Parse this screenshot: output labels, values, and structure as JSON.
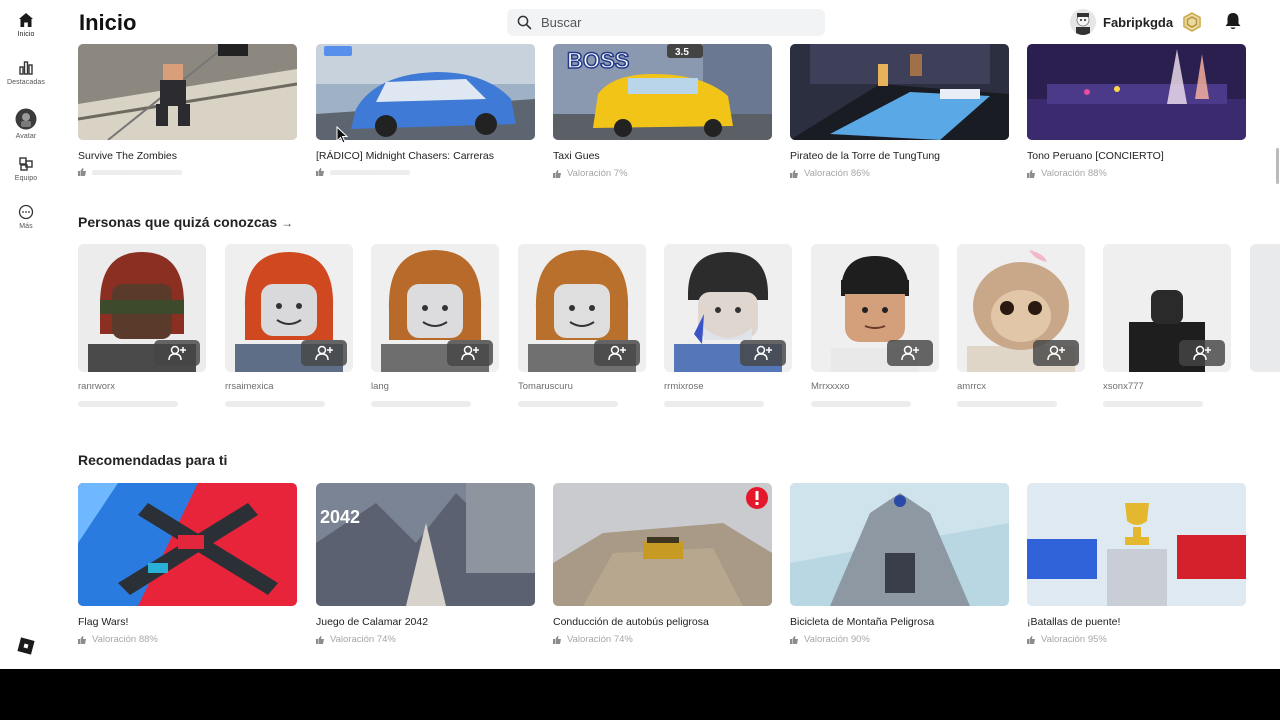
{
  "header": {
    "title": "Inicio",
    "search_placeholder": "Buscar",
    "username": "Fabripkgda"
  },
  "sidebar": {
    "items": [
      {
        "label": "Inicio",
        "icon": "home-icon"
      },
      {
        "label": "Destacadas",
        "icon": "charts-icon"
      },
      {
        "label": "Avatar",
        "icon": "avatar-icon"
      },
      {
        "label": "Equipo",
        "icon": "team-icon"
      },
      {
        "label": "Más",
        "icon": "more-icon"
      }
    ]
  },
  "continue_row": {
    "games": [
      {
        "title": "Survive The Zombies",
        "rating": ""
      },
      {
        "title": "[RÁDICO] Midnight Chasers: Carreras",
        "rating": ""
      },
      {
        "title": "Taxi Gues",
        "rating": "Valoración 7%"
      },
      {
        "title": "Pirateo de la Torre de TungTung",
        "rating": "Valoración 86%"
      },
      {
        "title": "Tono Peruano [CONCIERTO]",
        "rating": "Valoración 88%"
      }
    ]
  },
  "people_section": {
    "title": "Personas que quizá conozcas",
    "arrow": "→",
    "people": [
      {
        "name": "ranrworx"
      },
      {
        "name": "rrsaimexica"
      },
      {
        "name": "lang"
      },
      {
        "name": "Tomaruscuru"
      },
      {
        "name": "rrmixrose"
      },
      {
        "name": "Mrrxxxxo"
      },
      {
        "name": "amrrcx"
      },
      {
        "name": "xsonx777"
      }
    ]
  },
  "recommended_section": {
    "title": "Recomendadas para ti",
    "games": [
      {
        "title": "Flag Wars!",
        "rating": "Valoración 88%"
      },
      {
        "title": "Juego de Calamar 2042",
        "rating": "Valoración 74%"
      },
      {
        "title": "Conducción de autobús peligrosa",
        "rating": "Valoración 74%"
      },
      {
        "title": "Bicicleta de Montaña Peligrosa",
        "rating": "Valoración 90%"
      },
      {
        "title": "¡Batallas de puente!",
        "rating": "Valoración 95%"
      }
    ],
    "thumb_texts": {
      "squid": "2042",
      "taxi": "BOSS",
      "taxi_badge": "3.5"
    }
  },
  "colors": {
    "background": "#ffffff",
    "text": "#222222",
    "muted": "#888888",
    "alert_badge": "#e5172b"
  }
}
